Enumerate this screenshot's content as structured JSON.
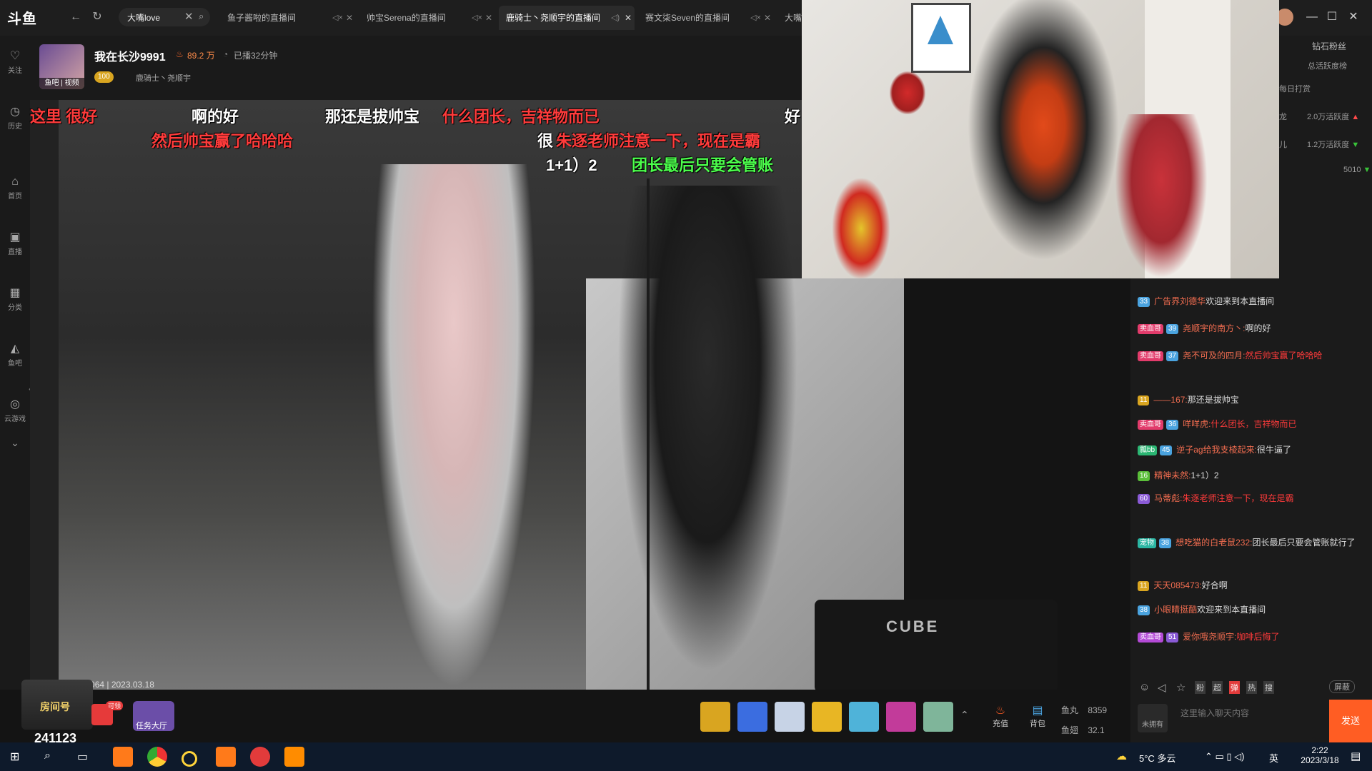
{
  "topbar": {
    "logo": "斗鱼",
    "search_value": "大嘴love",
    "tabs": [
      {
        "label": "鱼子酱啦的直播间"
      },
      {
        "label": "帅宝Serena的直播间"
      },
      {
        "label": "鹿骑士丶尧顺宇的直播间"
      },
      {
        "label": "赛文柒Seven的直播间"
      },
      {
        "label": "大嘴"
      }
    ]
  },
  "sidebar": {
    "items": [
      {
        "label": "关注",
        "icon": "heart-icon"
      },
      {
        "label": "历史",
        "icon": "clock-icon"
      },
      {
        "label": "首页",
        "icon": "home-icon"
      },
      {
        "label": "直播",
        "icon": "tv-icon"
      },
      {
        "label": "分类",
        "icon": "grid-icon"
      },
      {
        "label": "鱼吧",
        "icon": "fish-icon"
      },
      {
        "label": "云游戏",
        "icon": "gamepad-icon"
      }
    ]
  },
  "header": {
    "streamer": "我在长沙9991",
    "heat": "89.2 万",
    "duration": "已播32分钟",
    "avatar_caption": "鱼吧 | 视频",
    "fan_level": "100",
    "fan_tag": "鹿骑士丶尧顺宇"
  },
  "danmaku": [
    {
      "text": "这里 很好",
      "color": "#ff3b3b"
    },
    {
      "text": "啊的好",
      "color": "#ffffff"
    },
    {
      "text": "那还是拔帅宝",
      "color": "#ffffff"
    },
    {
      "text": "什么团长，吉祥物而已",
      "color": "#ff3b3b"
    },
    {
      "text": "好",
      "color": "#ffffff"
    },
    {
      "text": "然后帅宝赢了哈哈哈",
      "color": "#ff3b3b"
    },
    {
      "text": "很",
      "color": "#ffffff"
    },
    {
      "text": "朱逐老师注意一下，现在是霸",
      "color": "#ff3b3b"
    },
    {
      "text": "1+1）2",
      "color": "#ffffff"
    },
    {
      "text": "团长最后只要会管账",
      "color": "#4cff4c"
    }
  ],
  "video": {
    "amp_brand": "CUBE",
    "watermark": "斗鱼 房间号: 109064 | 2023.03.18"
  },
  "bottom": {
    "room_number": "241123",
    "room_label": "房间号",
    "task_label": "任务大厅",
    "gift_badge": "可领",
    "recharge_label": "充值",
    "backpack_label": "背包",
    "fish_ball_label": "鱼丸",
    "fish_ball_value": "8359",
    "fish_fin_label": "鱼翅",
    "fish_fin_value": "32.1"
  },
  "rightpanel": {
    "title": "钻石粉丝",
    "subtitle": "总活跃度榜",
    "rows": [
      {
        "label": "每日打赏",
        "value": ""
      },
      {
        "label": "龙",
        "value": "2.0万活跃度"
      },
      {
        "label": "儿",
        "value": "1.2万活跃度"
      },
      {
        "label": "",
        "value": "5010"
      }
    ]
  },
  "chat": {
    "messages": [
      {
        "badge": "",
        "level": "33",
        "user": "广告界刘德华",
        "text": "欢迎来到本直播间"
      },
      {
        "badge": "卖血哥",
        "level": "39",
        "user": "尧顺宇的南方丶:",
        "text": "啊的好"
      },
      {
        "badge": "卖血哥",
        "level": "37",
        "user": "尧不可及的四月:",
        "text": "然后帅宝赢了哈哈哈"
      },
      {
        "badge": "",
        "level": "11",
        "user": "——167:",
        "text": "那还是拔帅宝"
      },
      {
        "badge": "卖血哥",
        "level": "36",
        "user": "咩咩虎:",
        "text": "什么团长，吉祥物而已"
      },
      {
        "badge": "瓢bb",
        "level": "45",
        "user": "逆子ag给我支棱起来:",
        "text": "很牛逼了"
      },
      {
        "badge": "",
        "level": "16",
        "user": "精神未然:",
        "text": "1+1）2"
      },
      {
        "badge": "",
        "level": "60",
        "user": "马蒂彪:",
        "text": "朱逐老师注意一下，现在是霸"
      },
      {
        "badge": "宠物",
        "level": "38",
        "user": "想吃猫的白老鼠232:",
        "text": "团长最后只要会管账就行了"
      },
      {
        "badge": "",
        "level": "11",
        "user": "天天085473:",
        "text": "好合啊"
      },
      {
        "badge": "",
        "level": "38",
        "user": "小眼睛挺酷",
        "text": "欢迎来到本直播间"
      },
      {
        "badge": "卖血哥",
        "level": "51",
        "user": "爱你哦尧顺宇:",
        "text": "咖啡后悔了"
      }
    ],
    "tool_icons": [
      "smile-icon",
      "horn-icon",
      "star-icon",
      "粉",
      "超",
      "弹",
      "热",
      "搜"
    ],
    "block_label": "屏蔽",
    "input_placeholder": "这里输入聊天内容",
    "not_owned": "未拥有",
    "send_label": "发送"
  },
  "taskbar": {
    "weather": "5°C 多云",
    "ime": "英",
    "time": "2:22",
    "date": "2023/3/18"
  },
  "colors": {
    "accent": "#ff5d23",
    "danmaku_red": "#ff3b3b",
    "danmaku_green": "#4cff4c"
  }
}
